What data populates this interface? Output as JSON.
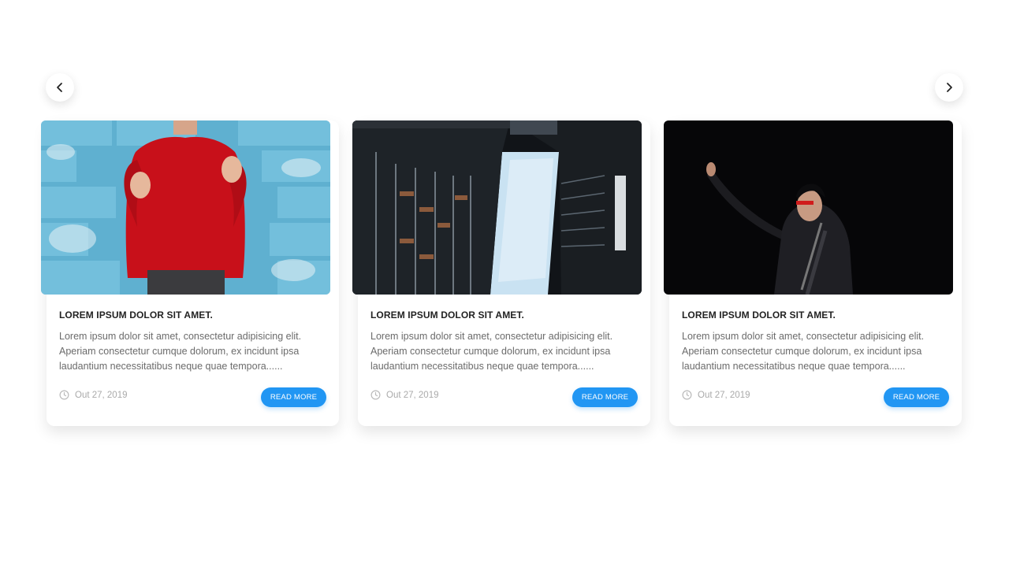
{
  "navigation": {
    "prev_icon": "chevron-left-icon",
    "next_icon": "chevron-right-icon"
  },
  "cards": [
    {
      "image": "man-in-red-sweater-photo",
      "title": "LOREM IPSUM DOLOR SIT AMET.",
      "text": "Lorem ipsum dolor sit amet, consectetur adipisicing elit. Aperiam consectetur cumque dolorum, ex incidunt ipsa laudantium necessitatibus neque quae tempora......",
      "date": "Out 27, 2019",
      "button_label": "READ MORE"
    },
    {
      "image": "skyscrapers-looking-up-photo",
      "title": "LOREM IPSUM DOLOR SIT AMET.",
      "text": "Lorem ipsum dolor sit amet, consectetur adipisicing elit. Aperiam consectetur cumque dolorum, ex incidunt ipsa laudantium necessitatibus neque quae tempora......",
      "date": "Out 27, 2019",
      "button_label": "READ MORE"
    },
    {
      "image": "person-with-mask-pointing-photo",
      "title": "LOREM IPSUM DOLOR SIT AMET.",
      "text": "Lorem ipsum dolor sit amet, consectetur adipisicing elit. Aperiam consectetur cumque dolorum, ex incidunt ipsa laudantium necessitatibus neque quae tempora......",
      "date": "Out 27, 2019",
      "button_label": "READ MORE"
    }
  ],
  "colors": {
    "accent": "#2196f3",
    "title": "#222222",
    "body_text": "#6b6b6b",
    "date_text": "#aaaaaa"
  }
}
